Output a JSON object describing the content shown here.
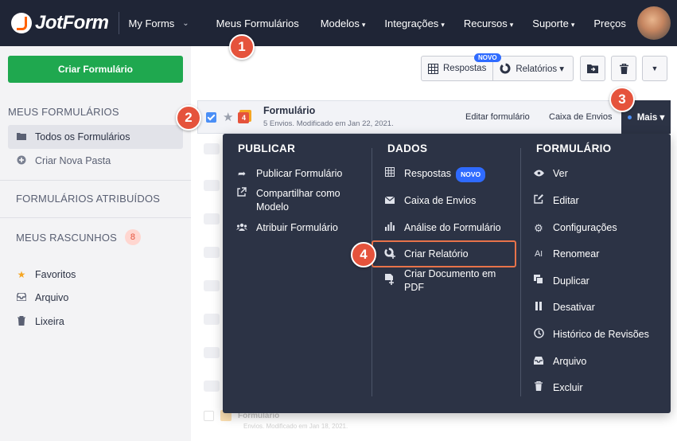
{
  "topbar": {
    "logo_text": "JotForm",
    "my_forms": "My Forms",
    "nav": [
      {
        "label": "Meus Formulários",
        "caret": ""
      },
      {
        "label": "Modelos",
        "caret": "▾"
      },
      {
        "label": "Integrações",
        "caret": "▾"
      },
      {
        "label": "Recursos",
        "caret": "▾"
      },
      {
        "label": "Suporte",
        "caret": "▾"
      },
      {
        "label": "Preços",
        "caret": ""
      }
    ]
  },
  "sidebar": {
    "create_button": "Criar Formulário",
    "heading_forms": "MEUS FORMULÁRIOS",
    "all_forms": "Todos os Formulários",
    "new_folder": "Criar Nova Pasta",
    "heading_assigned": "FORMULÁRIOS ATRIBUÍDOS",
    "heading_drafts": "MEUS RASCUNHOS",
    "drafts_count": "8",
    "favorites": "Favoritos",
    "archive": "Arquivo",
    "trash": "Lixeira"
  },
  "toolbar": {
    "responses": "Respostas",
    "novo": "NOVO",
    "reports": "Relatórios ▾"
  },
  "form_row": {
    "title": "Formulário",
    "subtitle": "5 Envios. Modificado em Jan 22, 2021.",
    "icon_number": "4",
    "edit": "Editar formulário",
    "inbox": "Caixa de Envios",
    "more": "Mais ▾"
  },
  "ghost_row": {
    "title": "Formulário",
    "subtitle": "Envios. Modificado em Jan 18, 2021."
  },
  "menu": {
    "publish": {
      "title": "PUBLICAR",
      "items": [
        "Publicar Formulário",
        "Compartilhar como Modelo",
        "Atribuir Formulário"
      ]
    },
    "data": {
      "title": "DADOS",
      "items": [
        "Respostas",
        "Caixa de Envios",
        "Análise do Formulário",
        "Criar Relatório",
        "Criar Documento em PDF"
      ],
      "novo": "NOVO"
    },
    "form": {
      "title": "FORMULÁRIO",
      "items": [
        "Ver",
        "Editar",
        "Configurações",
        "Renomear",
        "Duplicar",
        "Desativar",
        "Histórico de Revisões",
        "Arquivo",
        "Excluir"
      ]
    }
  },
  "steps": [
    "1",
    "2",
    "3",
    "4"
  ],
  "colors": {
    "nav_bg": "#1f2536",
    "menu_bg": "#2c3345",
    "create_green": "#1fa84f",
    "step_red": "#e5533c",
    "novo_blue": "#2f6bff",
    "highlight": "#e8734a"
  }
}
